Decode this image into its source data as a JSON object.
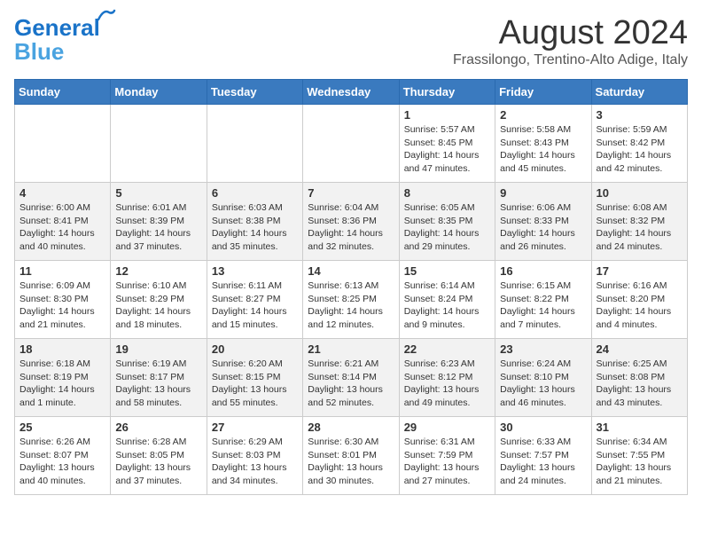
{
  "header": {
    "logo_line1": "General",
    "logo_line2": "Blue",
    "main_title": "August 2024",
    "sub_title": "Frassilongo, Trentino-Alto Adige, Italy"
  },
  "calendar": {
    "days_of_week": [
      "Sunday",
      "Monday",
      "Tuesday",
      "Wednesday",
      "Thursday",
      "Friday",
      "Saturday"
    ],
    "weeks": [
      [
        {
          "day": "",
          "info": ""
        },
        {
          "day": "",
          "info": ""
        },
        {
          "day": "",
          "info": ""
        },
        {
          "day": "",
          "info": ""
        },
        {
          "day": "1",
          "info": "Sunrise: 5:57 AM\nSunset: 8:45 PM\nDaylight: 14 hours and 47 minutes."
        },
        {
          "day": "2",
          "info": "Sunrise: 5:58 AM\nSunset: 8:43 PM\nDaylight: 14 hours and 45 minutes."
        },
        {
          "day": "3",
          "info": "Sunrise: 5:59 AM\nSunset: 8:42 PM\nDaylight: 14 hours and 42 minutes."
        }
      ],
      [
        {
          "day": "4",
          "info": "Sunrise: 6:00 AM\nSunset: 8:41 PM\nDaylight: 14 hours and 40 minutes."
        },
        {
          "day": "5",
          "info": "Sunrise: 6:01 AM\nSunset: 8:39 PM\nDaylight: 14 hours and 37 minutes."
        },
        {
          "day": "6",
          "info": "Sunrise: 6:03 AM\nSunset: 8:38 PM\nDaylight: 14 hours and 35 minutes."
        },
        {
          "day": "7",
          "info": "Sunrise: 6:04 AM\nSunset: 8:36 PM\nDaylight: 14 hours and 32 minutes."
        },
        {
          "day": "8",
          "info": "Sunrise: 6:05 AM\nSunset: 8:35 PM\nDaylight: 14 hours and 29 minutes."
        },
        {
          "day": "9",
          "info": "Sunrise: 6:06 AM\nSunset: 8:33 PM\nDaylight: 14 hours and 26 minutes."
        },
        {
          "day": "10",
          "info": "Sunrise: 6:08 AM\nSunset: 8:32 PM\nDaylight: 14 hours and 24 minutes."
        }
      ],
      [
        {
          "day": "11",
          "info": "Sunrise: 6:09 AM\nSunset: 8:30 PM\nDaylight: 14 hours and 21 minutes."
        },
        {
          "day": "12",
          "info": "Sunrise: 6:10 AM\nSunset: 8:29 PM\nDaylight: 14 hours and 18 minutes."
        },
        {
          "day": "13",
          "info": "Sunrise: 6:11 AM\nSunset: 8:27 PM\nDaylight: 14 hours and 15 minutes."
        },
        {
          "day": "14",
          "info": "Sunrise: 6:13 AM\nSunset: 8:25 PM\nDaylight: 14 hours and 12 minutes."
        },
        {
          "day": "15",
          "info": "Sunrise: 6:14 AM\nSunset: 8:24 PM\nDaylight: 14 hours and 9 minutes."
        },
        {
          "day": "16",
          "info": "Sunrise: 6:15 AM\nSunset: 8:22 PM\nDaylight: 14 hours and 7 minutes."
        },
        {
          "day": "17",
          "info": "Sunrise: 6:16 AM\nSunset: 8:20 PM\nDaylight: 14 hours and 4 minutes."
        }
      ],
      [
        {
          "day": "18",
          "info": "Sunrise: 6:18 AM\nSunset: 8:19 PM\nDaylight: 14 hours and 1 minute."
        },
        {
          "day": "19",
          "info": "Sunrise: 6:19 AM\nSunset: 8:17 PM\nDaylight: 13 hours and 58 minutes."
        },
        {
          "day": "20",
          "info": "Sunrise: 6:20 AM\nSunset: 8:15 PM\nDaylight: 13 hours and 55 minutes."
        },
        {
          "day": "21",
          "info": "Sunrise: 6:21 AM\nSunset: 8:14 PM\nDaylight: 13 hours and 52 minutes."
        },
        {
          "day": "22",
          "info": "Sunrise: 6:23 AM\nSunset: 8:12 PM\nDaylight: 13 hours and 49 minutes."
        },
        {
          "day": "23",
          "info": "Sunrise: 6:24 AM\nSunset: 8:10 PM\nDaylight: 13 hours and 46 minutes."
        },
        {
          "day": "24",
          "info": "Sunrise: 6:25 AM\nSunset: 8:08 PM\nDaylight: 13 hours and 43 minutes."
        }
      ],
      [
        {
          "day": "25",
          "info": "Sunrise: 6:26 AM\nSunset: 8:07 PM\nDaylight: 13 hours and 40 minutes."
        },
        {
          "day": "26",
          "info": "Sunrise: 6:28 AM\nSunset: 8:05 PM\nDaylight: 13 hours and 37 minutes."
        },
        {
          "day": "27",
          "info": "Sunrise: 6:29 AM\nSunset: 8:03 PM\nDaylight: 13 hours and 34 minutes."
        },
        {
          "day": "28",
          "info": "Sunrise: 6:30 AM\nSunset: 8:01 PM\nDaylight: 13 hours and 30 minutes."
        },
        {
          "day": "29",
          "info": "Sunrise: 6:31 AM\nSunset: 7:59 PM\nDaylight: 13 hours and 27 minutes."
        },
        {
          "day": "30",
          "info": "Sunrise: 6:33 AM\nSunset: 7:57 PM\nDaylight: 13 hours and 24 minutes."
        },
        {
          "day": "31",
          "info": "Sunrise: 6:34 AM\nSunset: 7:55 PM\nDaylight: 13 hours and 21 minutes."
        }
      ]
    ]
  }
}
